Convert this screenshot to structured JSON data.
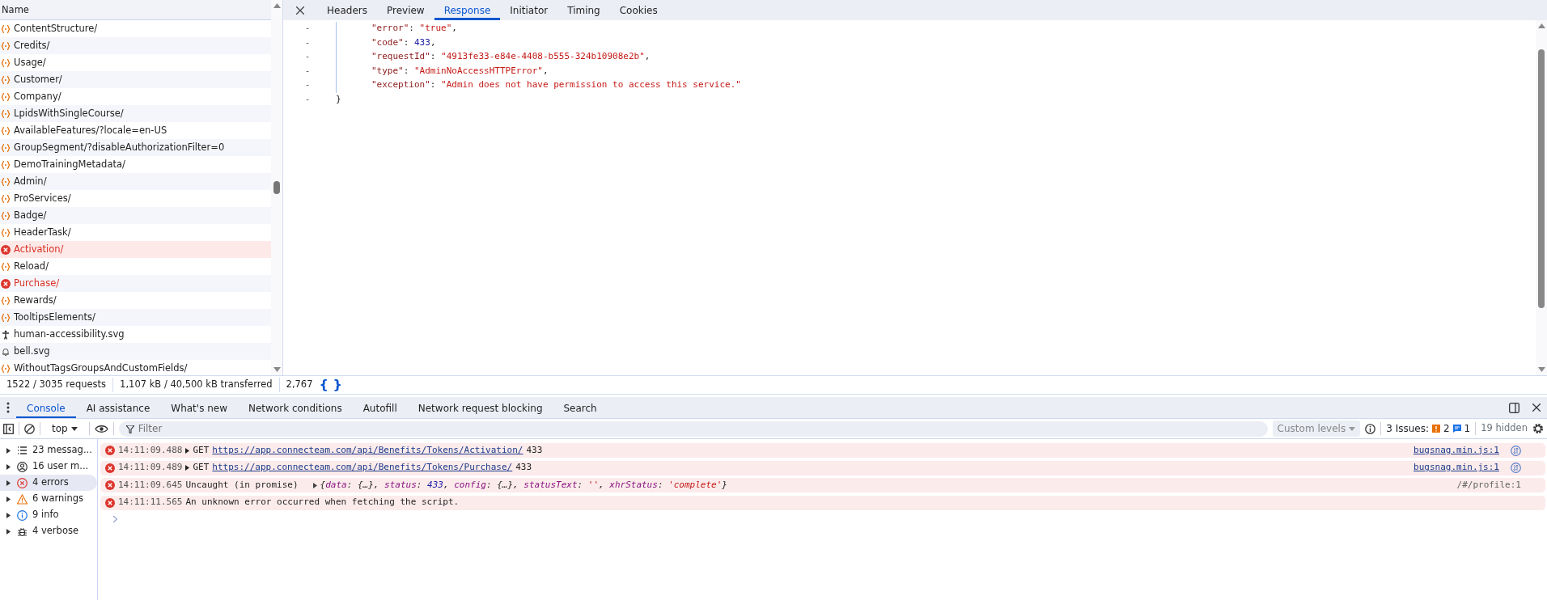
{
  "network": {
    "column_header": "Name",
    "requests": [
      {
        "name": "ContentStructure/",
        "kind": "fetch",
        "selected": false
      },
      {
        "name": "Credits/",
        "kind": "fetch",
        "selected": false
      },
      {
        "name": "Usage/",
        "kind": "fetch",
        "selected": false
      },
      {
        "name": "Customer/",
        "kind": "fetch",
        "selected": false
      },
      {
        "name": "Company/",
        "kind": "fetch",
        "selected": false
      },
      {
        "name": "LpidsWithSingleCourse/",
        "kind": "fetch",
        "selected": false
      },
      {
        "name": "AvailableFeatures/?locale=en-US",
        "kind": "fetch",
        "selected": false
      },
      {
        "name": "GroupSegment/?disableAuthorizationFilter=0",
        "kind": "fetch",
        "selected": false
      },
      {
        "name": "DemoTrainingMetadata/",
        "kind": "fetch",
        "selected": false
      },
      {
        "name": "Admin/",
        "kind": "fetch",
        "selected": false
      },
      {
        "name": "ProServices/",
        "kind": "fetch",
        "selected": false
      },
      {
        "name": "Badge/",
        "kind": "fetch",
        "selected": false
      },
      {
        "name": "HeaderTask/",
        "kind": "fetch",
        "selected": false
      },
      {
        "name": "Activation/",
        "kind": "failed",
        "selected": true
      },
      {
        "name": "Reload/",
        "kind": "fetch",
        "selected": false
      },
      {
        "name": "Purchase/",
        "kind": "failed",
        "selected": false
      },
      {
        "name": "Rewards/",
        "kind": "fetch",
        "selected": false
      },
      {
        "name": "TooltipsElements/",
        "kind": "fetch",
        "selected": false
      },
      {
        "name": "human-accessibility.svg",
        "kind": "figure",
        "selected": false
      },
      {
        "name": "bell.svg",
        "kind": "bell",
        "selected": false
      },
      {
        "name": "WithoutTagsGroupsAndCustomFields/",
        "kind": "fetch",
        "selected": false
      }
    ]
  },
  "detail_tabs": [
    {
      "label": "Headers",
      "selected": false
    },
    {
      "label": "Preview",
      "selected": false
    },
    {
      "label": "Response",
      "selected": true
    },
    {
      "label": "Initiator",
      "selected": false
    },
    {
      "label": "Timing",
      "selected": false
    },
    {
      "label": "Cookies",
      "selected": false
    }
  ],
  "response": {
    "lines": [
      {
        "gutter": "-",
        "indent": true,
        "segments": [
          {
            "t": "\"error\"",
            "kind": "key"
          },
          {
            "t": ": ",
            "kind": "punct"
          },
          {
            "t": "\"true\"",
            "kind": "string"
          },
          {
            "t": ",",
            "kind": "punct"
          }
        ]
      },
      {
        "gutter": "-",
        "indent": true,
        "segments": [
          {
            "t": "\"code\"",
            "kind": "key"
          },
          {
            "t": ": ",
            "kind": "punct"
          },
          {
            "t": "433",
            "kind": "number"
          },
          {
            "t": ",",
            "kind": "punct"
          }
        ]
      },
      {
        "gutter": "-",
        "indent": true,
        "segments": [
          {
            "t": "\"requestId\"",
            "kind": "key"
          },
          {
            "t": ": ",
            "kind": "punct"
          },
          {
            "t": "\"4913fe33-e84e-4408-b555-324b10908e2b\"",
            "kind": "string"
          },
          {
            "t": ",",
            "kind": "punct"
          }
        ]
      },
      {
        "gutter": "-",
        "indent": true,
        "segments": [
          {
            "t": "\"type\"",
            "kind": "key"
          },
          {
            "t": ": ",
            "kind": "punct"
          },
          {
            "t": "\"AdminNoAccessHTTPError\"",
            "kind": "string"
          },
          {
            "t": ",",
            "kind": "punct"
          }
        ]
      },
      {
        "gutter": "-",
        "indent": true,
        "segments": [
          {
            "t": "\"exception\"",
            "kind": "key"
          },
          {
            "t": ": ",
            "kind": "punct"
          },
          {
            "t": "\"Admin does not have permission to access this service.\"",
            "kind": "string"
          }
        ]
      },
      {
        "gutter": "-",
        "indent": false,
        "segments": [
          {
            "t": "}",
            "kind": "punct"
          }
        ]
      }
    ]
  },
  "status_bar": {
    "items": [
      "1522 / 3035 requests",
      "1,107 kB / 40,500 kB transferred",
      "2,767"
    ],
    "pretty_print": "{ }"
  },
  "drawer_tabs": [
    {
      "label": "Console",
      "selected": true
    },
    {
      "label": "AI assistance",
      "selected": false
    },
    {
      "label": "What's new",
      "selected": false
    },
    {
      "label": "Network conditions",
      "selected": false
    },
    {
      "label": "Autofill",
      "selected": false
    },
    {
      "label": "Network request blocking",
      "selected": false
    },
    {
      "label": "Search",
      "selected": false
    }
  ],
  "console_toolbar": {
    "context": "top",
    "filter": {
      "placeholder": "Filter"
    },
    "levels": "Custom levels",
    "issues_label": "3 Issues:",
    "issue_warnings": "2",
    "issue_info": "1",
    "hidden": "19 hidden"
  },
  "console_sidebar": [
    {
      "label": "23 messag...",
      "kind": "messages",
      "selected": false
    },
    {
      "label": "16 user m...",
      "kind": "user",
      "selected": false
    },
    {
      "label": "4 errors",
      "kind": "errors",
      "selected": true
    },
    {
      "label": "6 warnings",
      "kind": "warnings",
      "selected": false
    },
    {
      "label": "9 info",
      "kind": "info",
      "selected": false
    },
    {
      "label": "4 verbose",
      "kind": "verbose",
      "selected": false
    }
  ],
  "console_messages": [
    {
      "kind": "request",
      "time": "14:11:09.488",
      "method": "GET",
      "url": "https://app.connecteam.com/api/Benefits/Tokens/Activation/",
      "status": "433",
      "source": "bugsnag.min.js:1"
    },
    {
      "kind": "request",
      "time": "14:11:09.489",
      "method": "GET",
      "url": "https://app.connecteam.com/api/Benefits/Tokens/Purchase/",
      "status": "433",
      "source": "bugsnag.min.js:1"
    },
    {
      "kind": "promise",
      "time": "14:11:09.645",
      "text": "Uncaught (in promise)",
      "segments": [
        {
          "t": "{",
          "kind": "punct"
        },
        {
          "t": "data",
          "kind": "prop"
        },
        {
          "t": ": {…}, ",
          "kind": "punct"
        },
        {
          "t": "status",
          "kind": "prop"
        },
        {
          "t": ": ",
          "kind": "punct"
        },
        {
          "t": "433",
          "kind": "number"
        },
        {
          "t": ", ",
          "kind": "punct"
        },
        {
          "t": "config",
          "kind": "prop"
        },
        {
          "t": ": {…}, ",
          "kind": "punct"
        },
        {
          "t": "statusText",
          "kind": "prop"
        },
        {
          "t": ": ",
          "kind": "punct"
        },
        {
          "t": "''",
          "kind": "string"
        },
        {
          "t": ", ",
          "kind": "punct"
        },
        {
          "t": "xhrStatus",
          "kind": "prop"
        },
        {
          "t": ": ",
          "kind": "punct"
        },
        {
          "t": "'complete'",
          "kind": "string"
        },
        {
          "t": "}",
          "kind": "punct"
        }
      ],
      "source": "/#/profile:1"
    },
    {
      "kind": "text",
      "time": "14:11:11.565",
      "text": "An unknown error occurred when fetching the script."
    }
  ]
}
